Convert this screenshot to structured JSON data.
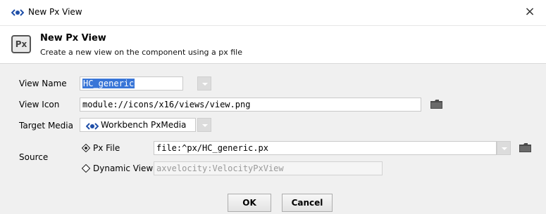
{
  "window": {
    "title": "New Px View",
    "close_glyph": "×"
  },
  "header": {
    "badge": "Px",
    "title": "New Px View",
    "subtitle": "Create a new view on the component using a px file"
  },
  "form": {
    "view_name_label": "View Name",
    "view_name_value": "HC_generic",
    "view_icon_label": "View Icon",
    "view_icon_value": "module://icons/x16/views/view.png",
    "target_media_label": "Target Media",
    "target_media_value": "Workbench PxMedia",
    "source_label": "Source",
    "px_file_label": "Px File",
    "px_file_value": "file:^px/HC_generic.px",
    "px_file_selected": true,
    "dynamic_view_label": "Dynamic View",
    "dynamic_view_value": "axvelocity:VelocityPxView",
    "dynamic_view_selected": false
  },
  "buttons": {
    "ok": "OK",
    "cancel": "Cancel"
  },
  "colors": {
    "accent": "#3875d7",
    "niagara_icon": "#1f4fa8",
    "folder": "#4a4a4a"
  },
  "icons": [
    "niagara-eye-icon",
    "px-badge-icon",
    "folder-icon",
    "dropdown-arrow-icon",
    "radio-icon",
    "close-icon"
  ]
}
